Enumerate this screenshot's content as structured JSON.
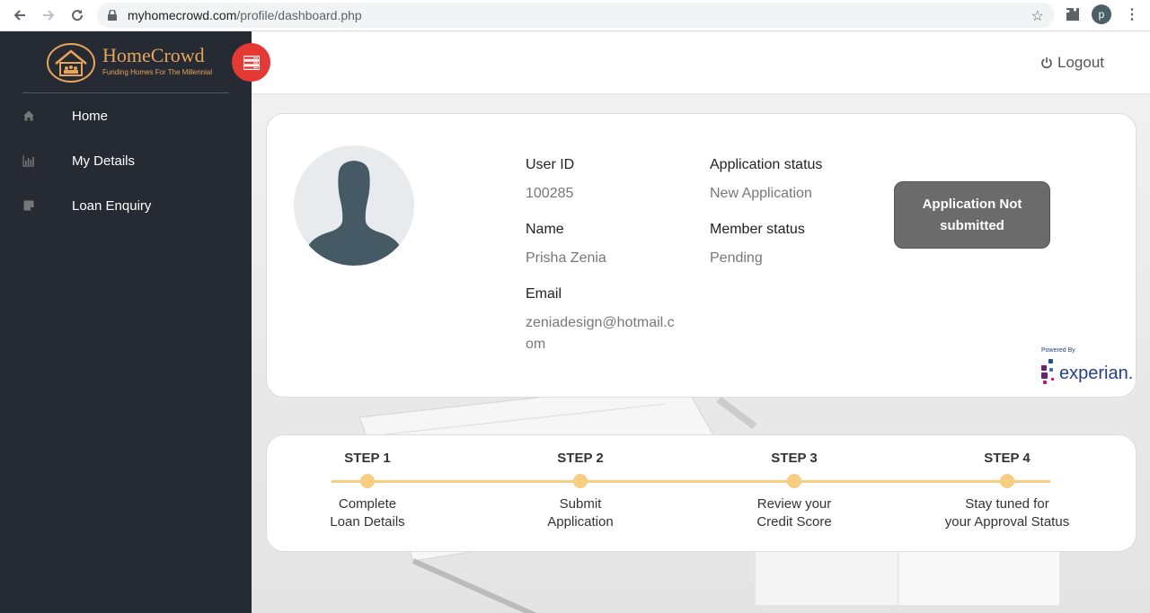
{
  "browser": {
    "url_host": "myhomecrowd.com",
    "url_path": "/profile/dashboard.php",
    "profile_initial": "p"
  },
  "brand": {
    "name": "HomeCrowd",
    "tagline": "Funding Homes For The Millennial",
    "accent_color": "#e8a45a"
  },
  "sidebar": {
    "items": [
      {
        "label": "Home",
        "icon": "home-icon"
      },
      {
        "label": "My Details",
        "icon": "bar-chart-icon"
      },
      {
        "label": "Loan Enquiry",
        "icon": "note-icon"
      }
    ]
  },
  "header": {
    "logout_label": "Logout"
  },
  "profile": {
    "user_id_label": "User ID",
    "user_id": "100285",
    "name_label": "Name",
    "name": "Prisha Zenia",
    "email_label": "Email",
    "email_line1": "zeniadesign@hotmail.c",
    "email_line2": "om",
    "app_status_label": "Application status",
    "app_status": "New Application",
    "member_status_label": "Member status",
    "member_status": "Pending",
    "status_button_line1": "Application Not",
    "status_button_line2": "submitted",
    "powered_by": "Powered By",
    "powered_by_brand": "experian."
  },
  "steps": [
    {
      "title": "STEP 1",
      "desc1": "Complete",
      "desc2": "Loan Details"
    },
    {
      "title": "STEP 2",
      "desc1": "Submit",
      "desc2": "Application"
    },
    {
      "title": "STEP 3",
      "desc1": "Review your",
      "desc2": "Credit Score"
    },
    {
      "title": "STEP 4",
      "desc1": "Stay tuned for",
      "desc2": "your Approval Status"
    }
  ]
}
